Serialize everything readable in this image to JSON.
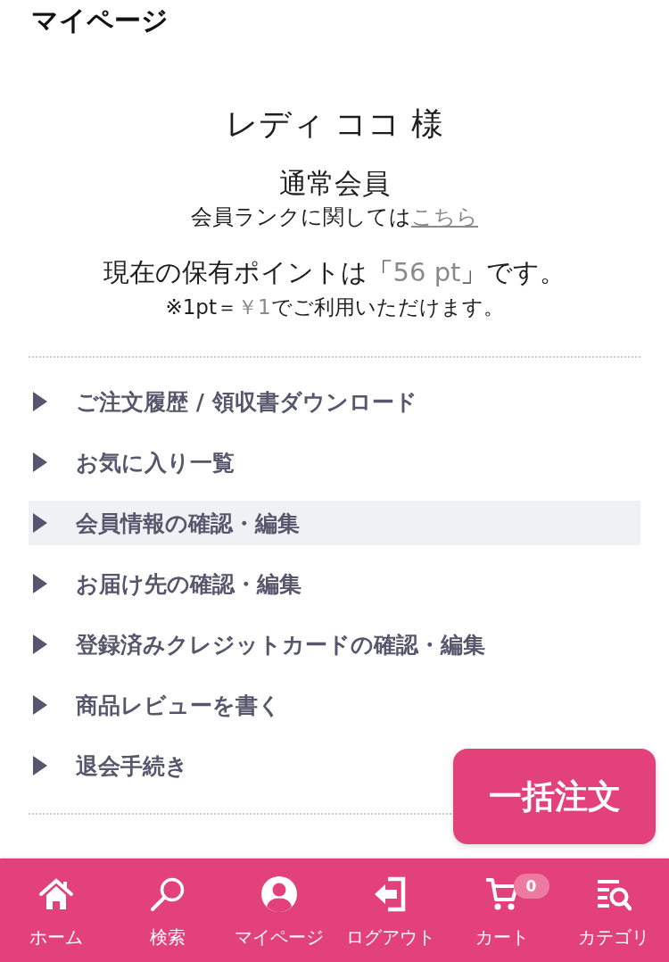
{
  "header": {
    "title": "マイページ"
  },
  "member": {
    "name": "レディ ココ 様",
    "rank": "通常会員",
    "rank_note": "会員ランクに関しては",
    "rank_link": "こちら",
    "points_prefix": "現在の保有ポイントは「",
    "points": "56 pt",
    "points_suffix": "」です。",
    "rate_prefix": "※1pt＝",
    "rate": "￥1",
    "rate_suffix": "でご利用いただけます。"
  },
  "menu": [
    {
      "label": "ご注文履歴 / 領収書ダウンロード",
      "selected": false
    },
    {
      "label": "お気に入り一覧",
      "selected": false
    },
    {
      "label": "会員情報の確認・編集",
      "selected": true
    },
    {
      "label": "お届け先の確認・編集",
      "selected": false
    },
    {
      "label": "登録済みクレジットカードの確認・編集",
      "selected": false
    },
    {
      "label": "商品レビューを書く",
      "selected": false
    },
    {
      "label": "退会手続き",
      "selected": false
    }
  ],
  "bulk_order_button": {
    "label": "一括注文"
  },
  "bottom_nav": [
    {
      "kind": "home",
      "label": "ホーム"
    },
    {
      "kind": "search",
      "label": "検索"
    },
    {
      "kind": "user",
      "label": "マイページ"
    },
    {
      "kind": "logout",
      "label": "ログアウト"
    },
    {
      "kind": "cart",
      "label": "カート",
      "badge": "0"
    },
    {
      "kind": "category",
      "label": "カテゴリ"
    }
  ]
}
